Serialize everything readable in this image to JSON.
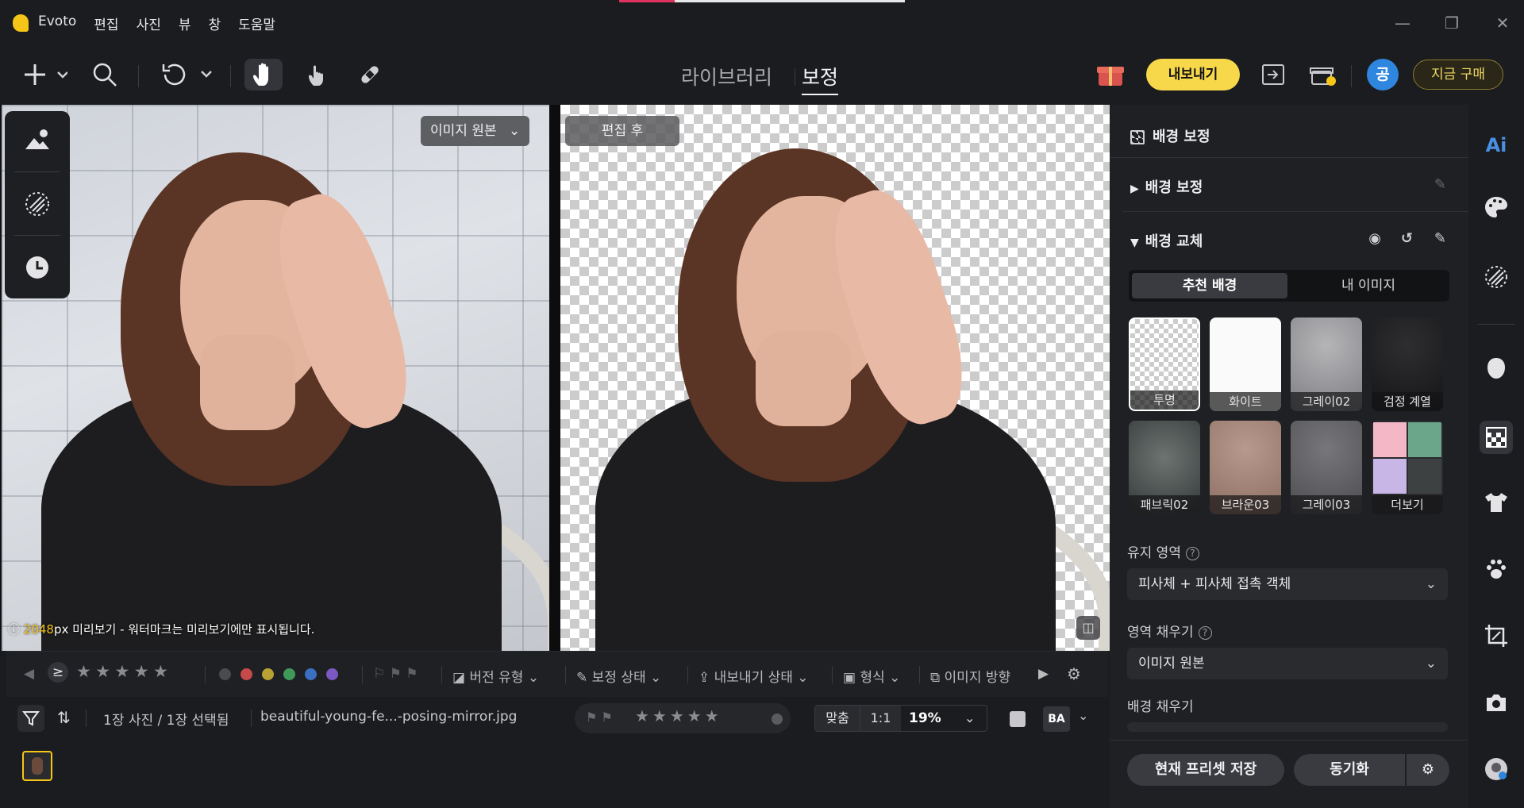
{
  "app": {
    "name": "Evoto"
  },
  "menu": [
    "편집",
    "사진",
    "뷰",
    "창",
    "도움말"
  ],
  "toolbar": {
    "modes": {
      "library": "라이브러리",
      "retouch": "보정"
    },
    "export_label": "내보내기",
    "avatar_letter": "공",
    "buy_label": "지금 구매"
  },
  "canvas": {
    "original_badge": "이미지 원본",
    "edited_badge": "편집 후",
    "watermark": {
      "size": "2048",
      "text": "px 미리보기 - 워터마크는 미리보기에만 표시됩니다."
    }
  },
  "filterbar": {
    "gte": "≥",
    "stars": 5,
    "colors": [
      "#4a4a4f",
      "#c74a4a",
      "#b9a234",
      "#3f9a5a",
      "#3a6fc2",
      "#7b58c2"
    ],
    "version_type": "버전 유형",
    "retouch_status": "보정 상태",
    "export_status": "내보내기 상태",
    "format": "형식",
    "image_orientation": "이미지 방향"
  },
  "infobar": {
    "count": "1장 사진 / 1장 선택됨",
    "filename": "beautiful-young-fe...-posing-mirror.jpg",
    "fit": "맞춤",
    "one_to_one": "1:1",
    "zoom": "19%",
    "ba": "BA"
  },
  "panel": {
    "title": "배경 보정",
    "section1": "배경 보정",
    "section2": "배경 교체",
    "tabs": {
      "recommended": "추천 배경",
      "mine": "내 이미지"
    },
    "backgrounds": [
      {
        "label": "투명"
      },
      {
        "label": "화이트"
      },
      {
        "label": "그레이02"
      },
      {
        "label": "검정 계열"
      },
      {
        "label": "패브릭02"
      },
      {
        "label": "브라운03"
      },
      {
        "label": "그레이03"
      },
      {
        "label": "더보기"
      }
    ],
    "keep_area": {
      "label": "유지 영역",
      "value": "피사체 + 피사체 접촉 객체"
    },
    "fill_area": {
      "label": "영역 채우기",
      "value": "이미지 원본"
    },
    "bg_fill": {
      "label": "배경 채우기"
    },
    "save_preset": "현재 프리셋 저장",
    "sync": "동기화"
  },
  "rail": {
    "ai_label": "Ai"
  }
}
